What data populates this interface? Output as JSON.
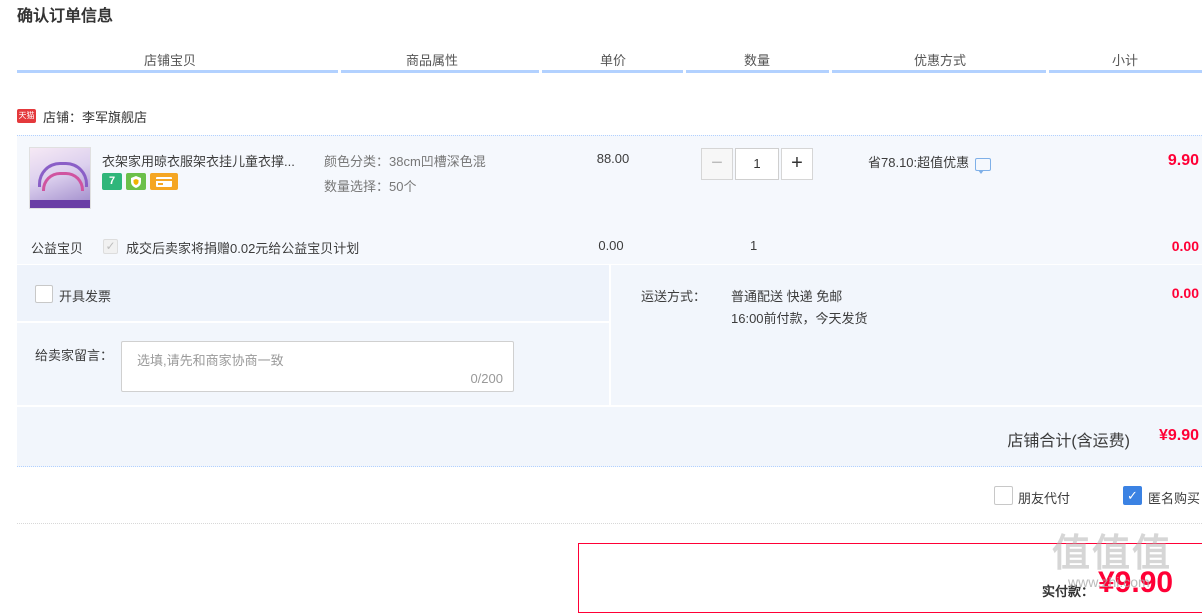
{
  "page": {
    "title": "确认订单信息"
  },
  "columns": [
    "店铺宝贝",
    "商品属性",
    "单价",
    "数量",
    "优惠方式",
    "小计"
  ],
  "shop": {
    "badge": "天猫",
    "label": "店铺：李军旗舰店"
  },
  "item": {
    "title": "衣架家用晾衣服架衣挂儿童衣撑...",
    "badges": [
      {
        "icon": "seven-day-return-icon",
        "text": "7",
        "color": "#2fb67a"
      },
      {
        "icon": "shield-badge-icon",
        "text": "",
        "color": "#6cc04a"
      },
      {
        "icon": "credit-card-icon",
        "text": "",
        "color": "#f5a623"
      }
    ],
    "attr_color": "颜色分类：38cm凹槽深色混",
    "attr_qty": "数量选择：50个",
    "unit_price": "88.00",
    "quantity": "1",
    "qty_minus": "−",
    "qty_plus": "+",
    "promo": "省78.10:超值优惠",
    "subtotal": "9.90"
  },
  "charity": {
    "label": "公益宝贝",
    "text": "成交后卖家将捐赠0.02元给公益宝贝计划",
    "price": "0.00",
    "qty": "1",
    "subtotal": "0.00"
  },
  "invoice": {
    "label": "开具发票"
  },
  "shipping": {
    "label": "运送方式：",
    "method": "普通配送 快递 免邮",
    "note": "16:00前付款，今天发货",
    "fee": "0.00"
  },
  "message": {
    "label": "给卖家留言：",
    "placeholder": "选填,请先和商家协商一致",
    "counter": "0/200"
  },
  "shop_total": {
    "label": "店铺合计(含运费)",
    "amount": "¥9.90"
  },
  "options": {
    "friend_pay": "朋友代付",
    "anonymous": "匿名购买"
  },
  "pay": {
    "label": "实付款：",
    "amount": "¥9.90"
  },
  "watermark": {
    "text": "值值值",
    "url": "www.zhi.com"
  },
  "colors": {
    "accent_red": "#ff0036",
    "column_bar": "#b2d1ff",
    "check_blue": "#3b82e3"
  }
}
